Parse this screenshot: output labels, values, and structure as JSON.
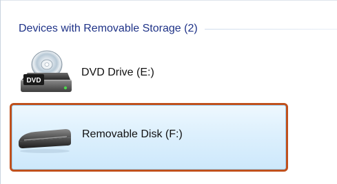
{
  "group": {
    "title": "Devices with Removable Storage (2)"
  },
  "devices": [
    {
      "label": "DVD Drive (E:)",
      "icon": "dvd-drive-icon",
      "badge": "DVD",
      "selected": false
    },
    {
      "label": "Removable Disk (F:)",
      "icon": "removable-disk-icon",
      "selected": true
    }
  ],
  "colors": {
    "group_title": "#1e3287",
    "selection_fill": "#ddf0fd",
    "selection_border": "#9fd0f2",
    "highlight_outline": "#c0501c"
  }
}
